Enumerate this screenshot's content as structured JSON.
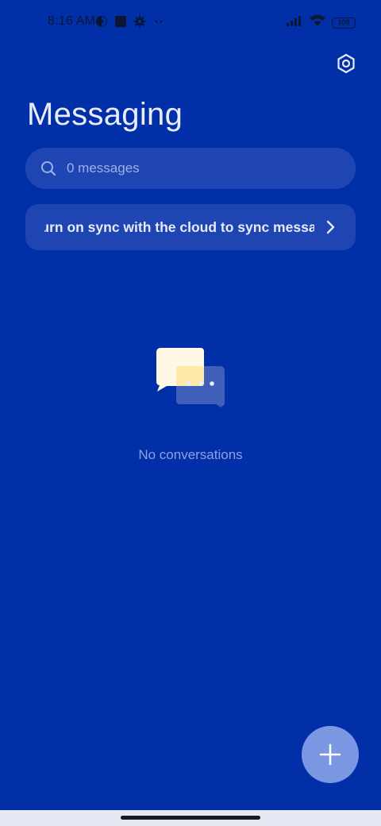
{
  "status_bar": {
    "time": "8:16 AM",
    "battery_level": "100",
    "icons_left": [
      "vpn-icon",
      "square-app-icon",
      "gear-notification-icon",
      "more-dots-icon"
    ],
    "icons_right": [
      "signal-icon",
      "wifi-icon",
      "battery-icon"
    ]
  },
  "header": {
    "title": "Messaging",
    "settings_icon": "settings-icon"
  },
  "search": {
    "placeholder": "0 messages",
    "icon": "search-icon"
  },
  "sync_banner": {
    "text": "Turn on sync with the cloud to sync messages",
    "icon": "chevron-right-icon"
  },
  "empty_state": {
    "illustration": "chat-bubbles-icon",
    "text": "No conversations"
  },
  "fab": {
    "icon": "plus-icon"
  },
  "colors": {
    "background": "#002fa8",
    "surface": "#1f45b3",
    "fab": "#7b96e3",
    "muted_text": "#8ea2e3"
  }
}
